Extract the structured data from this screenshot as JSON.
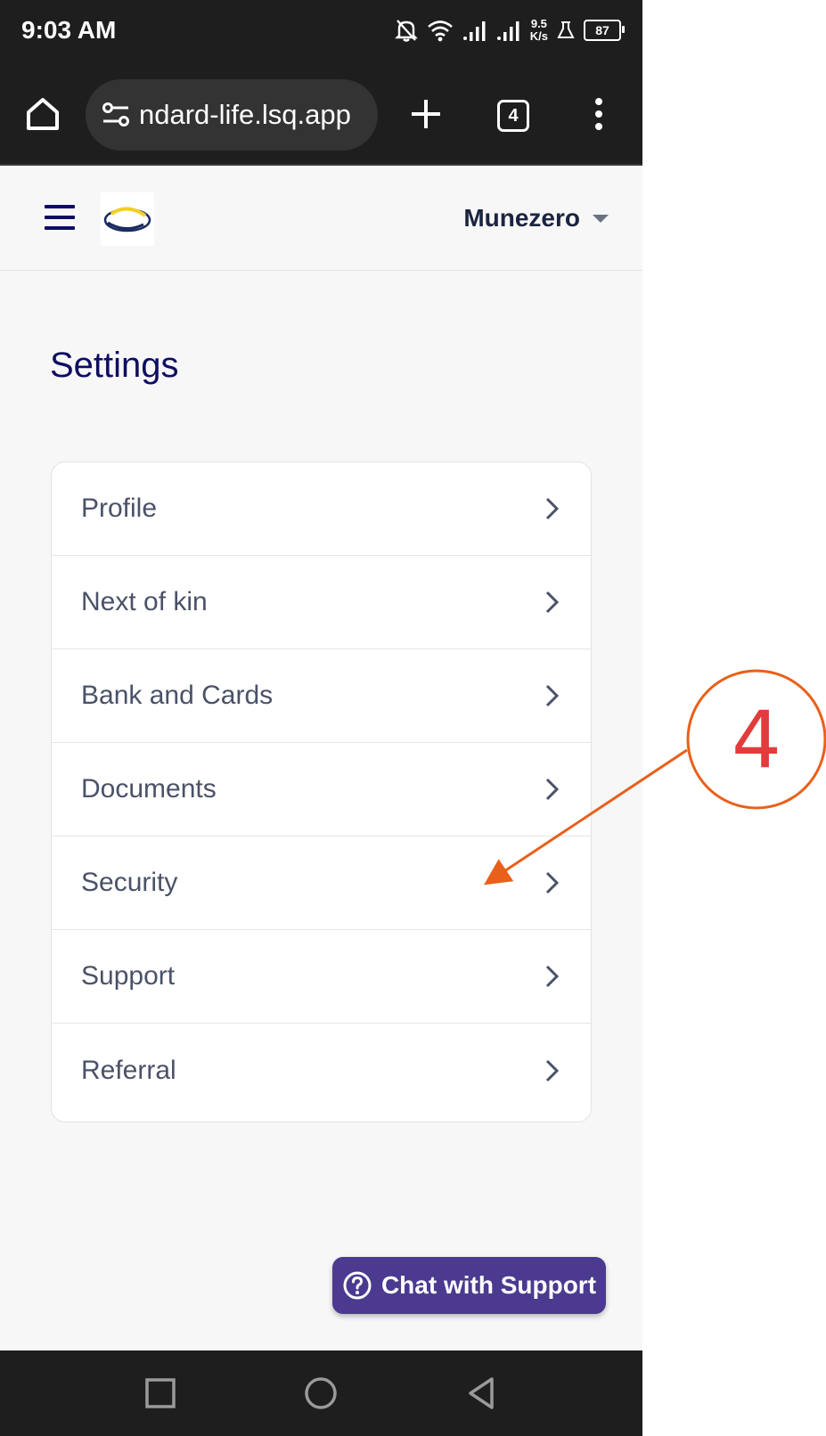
{
  "status_bar": {
    "time": "9:03 AM",
    "speed_value": "9.5",
    "speed_unit": "K/s",
    "battery": "87",
    "icons": [
      "bell-off-icon",
      "wifi-icon",
      "signal-icon",
      "signal-icon",
      "lab-icon",
      "battery-icon"
    ]
  },
  "browser": {
    "url": "ndard-life.lsq.app",
    "tab_count": "4",
    "icons": [
      "home-icon",
      "site-settings-icon",
      "plus-icon",
      "tabs-icon",
      "more-vert-icon"
    ]
  },
  "header": {
    "user_name": "Munezero",
    "icons": [
      "menu-icon",
      "logo",
      "caret-down-icon"
    ]
  },
  "page": {
    "title": "Settings"
  },
  "settings": {
    "items": [
      {
        "label": "Profile"
      },
      {
        "label": "Next of kin"
      },
      {
        "label": "Bank and Cards"
      },
      {
        "label": "Documents"
      },
      {
        "label": "Security"
      },
      {
        "label": "Support"
      },
      {
        "label": "Referral"
      }
    ]
  },
  "annotation": {
    "step_number": "4",
    "color": "#e8601a",
    "number_color": "#e23b3b"
  },
  "chat": {
    "label": "Chat with Support",
    "background": "#4b3a8f"
  },
  "navbar": {
    "icons": [
      "recents-square-icon",
      "home-circle-icon",
      "back-triangle-icon"
    ]
  }
}
